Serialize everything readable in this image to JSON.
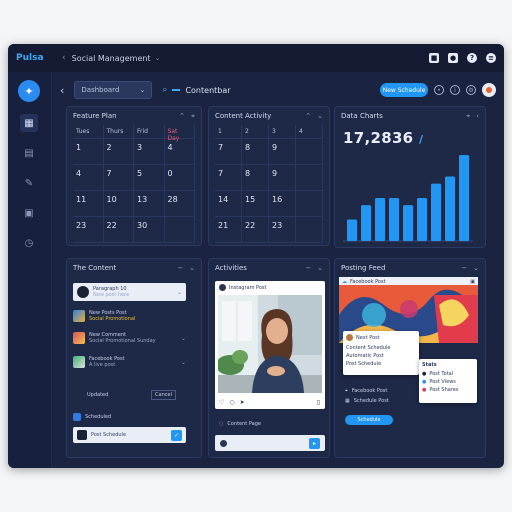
{
  "titlebar": {
    "brand": "Pulsa",
    "title": "Social Management"
  },
  "topbar": {
    "dropdown_value": "Dashboard",
    "search_label": "Contentbar",
    "primary_button": "New Schedule"
  },
  "panel_calendar_a": {
    "title": "Feature Plan",
    "headers": [
      "Tues",
      "Thurs",
      "Frid",
      "Sat Day"
    ],
    "cells": [
      "1",
      "2",
      "3",
      "4",
      "4",
      "7",
      "5",
      "0",
      "11",
      "10",
      "13",
      "28",
      "23",
      "22",
      "30",
      ""
    ]
  },
  "panel_calendar_b": {
    "title": "Content Activity",
    "headers": [
      "1",
      "2",
      "3",
      "4"
    ],
    "cells": [
      "7",
      "8",
      "9",
      "",
      "7",
      "8",
      "9",
      "",
      "14",
      "15",
      "16",
      "",
      "21",
      "22",
      "23",
      ""
    ]
  },
  "panel_stats": {
    "title": "Data Charts",
    "big_number": "17,2836",
    "big_number_suffix": "/",
    "chart_data": {
      "type": "bar",
      "values": [
        3,
        5,
        6,
        6,
        5,
        6,
        8,
        9,
        12
      ]
    }
  },
  "panel_posts": {
    "title": "The Content",
    "rows": [
      {
        "title": "Paragraph 10",
        "sub": "New post here"
      },
      {
        "title": "New Posts Post",
        "sub": "Social Promotional"
      },
      {
        "title": "New Comment",
        "sub": "Social Promotional Sunday"
      },
      {
        "title": "Facebook Post",
        "sub": "A live post"
      }
    ],
    "footer_left": "Updated",
    "footer_right": "Cancel",
    "section_label": "Scheduled",
    "bottom_row": "Post Schedule"
  },
  "panel_activity": {
    "title": "Activities",
    "post_user": "Instagram Post",
    "footer_label": "Content Page"
  },
  "panel_feed": {
    "title": "Posting Feed",
    "header_chip": "Facebook Post",
    "popup_title": "Next Post",
    "popup_lines": [
      "Content Schedule",
      "Automatic Post",
      "Post Schedule"
    ],
    "menu_title": "Stats",
    "menu_items": [
      "Post Total",
      "Post Views",
      "Post Shares"
    ],
    "links": [
      "Facebook Post",
      "Schedule Post"
    ],
    "cta": "Schedule"
  },
  "colors": {
    "accent": "#2196f3",
    "background": "#1a2340",
    "panel": "#1e2948"
  }
}
